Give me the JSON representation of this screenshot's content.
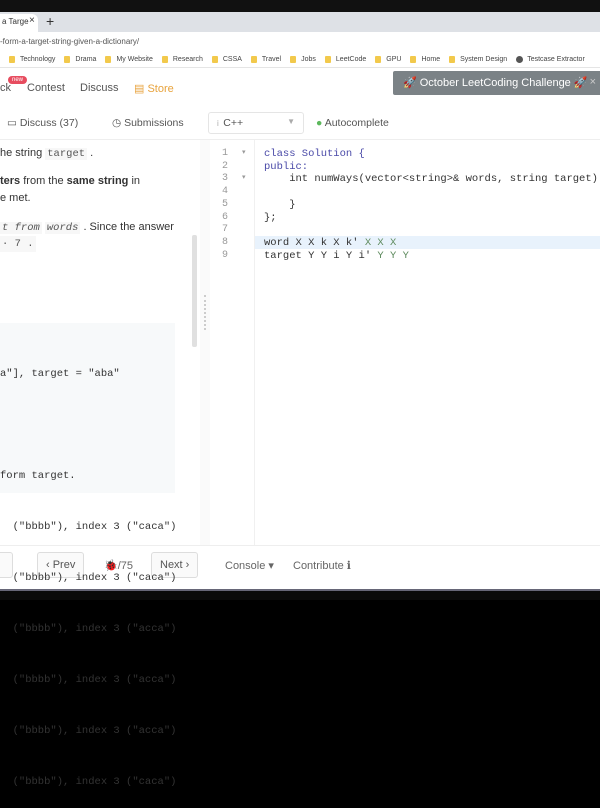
{
  "browser": {
    "tab_title": "a Targe",
    "new_tab": "+",
    "close": "×",
    "url": "-form-a-target-string-given-a-dictionary/",
    "bookmarks": [
      "Technology",
      "Drama",
      "My Website",
      "Research",
      "CSSA",
      "Travel",
      "Jobs",
      "LeetCode",
      "GPU",
      "Home",
      "System Design",
      "Testcase Extractor"
    ]
  },
  "nav": {
    "items": [
      "ck",
      "Contest",
      "Discuss",
      "Store"
    ],
    "badge": "new",
    "challenge": "🚀 October LeetCoding Challenge 🚀",
    "challenge_close": "×"
  },
  "toolbar": {
    "discuss": "Discuss (37)",
    "submissions": "Submissions",
    "language": "C++",
    "autocomplete": "Autocomplete"
  },
  "description": {
    "l1a": "he string ",
    "l1code": "target",
    "l1b": " .",
    "l2a": "ters",
    "l2b": " from the ",
    "l2c": "same string",
    "l2d": " in",
    "l3": "e met.",
    "l4a": "t from",
    "l4code": "words",
    "l4b": " . Since the answer",
    "l5": "· 7 .",
    "example": [
      "a\"], target = \"aba\"",
      "",
      "form target.",
      "  (\"bbbb\"), index 3 (\"caca\")",
      "  (\"bbbb\"), index 3 (\"caca\")",
      "  (\"bbbb\"), index 3 (\"acca\")",
      "  (\"bbbb\"), index 3 (\"acca\")",
      "  (\"bbbb\"), index 3 (\"acca\")",
      "  (\"bbbb\"), index 3 (\"caca\")"
    ]
  },
  "editor": {
    "line_numbers": [
      "1",
      "2",
      "3",
      "4",
      "5",
      "6",
      "7",
      "8",
      "9"
    ],
    "lines": [
      {
        "a": "class Solution {",
        "k": ""
      },
      {
        "a": "public:",
        "k": ""
      },
      {
        "a": "    int numWays(vector<string>& words, string target) {",
        "k": ""
      },
      {
        "a": "",
        "k": ""
      },
      {
        "a": "    }",
        "k": ""
      },
      {
        "a": "};",
        "k": ""
      },
      {
        "a": "",
        "k": ""
      },
      {
        "a": "word X X k X k' ",
        "k": "X X X"
      },
      {
        "a": "target Y Y i Y i' ",
        "k": "Y Y Y"
      }
    ]
  },
  "footer": {
    "prev": "‹ Prev",
    "counter": "🐞/75",
    "next": "Next ›",
    "console": "Console ▾",
    "contribute": "Contribute ℹ"
  }
}
